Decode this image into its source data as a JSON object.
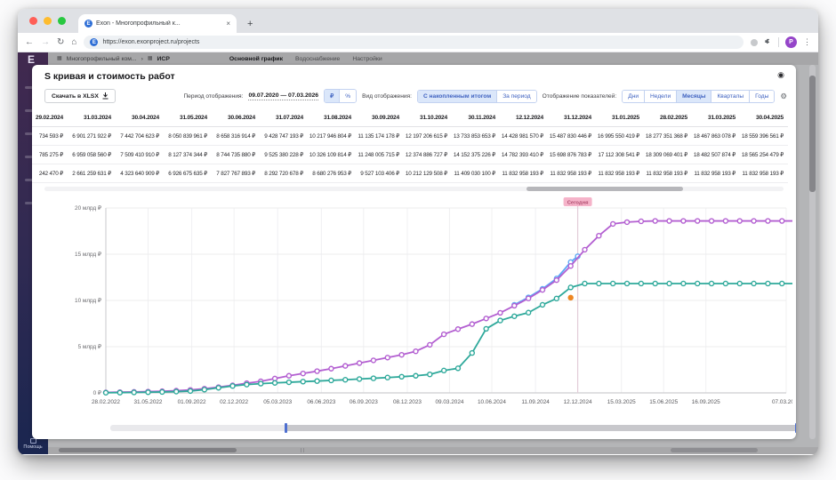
{
  "browser": {
    "tab_title": "Exon - Многопрофильный к...",
    "tab_close": "×",
    "new_tab": "+",
    "url": "https://exon.exonproject.ru/projects",
    "favicon_letter": "E",
    "avatar_letter": "P",
    "back_icon": "←",
    "forward_icon": "→",
    "reload_icon": "↻",
    "home_icon": "⌂",
    "kebab_icon": "⋮"
  },
  "app": {
    "logo_letter": "E",
    "help_label": "Помощь",
    "breadcrumb": {
      "project": "Многопрофильный ком...",
      "separator": "›",
      "current": "ИСР"
    },
    "nav_tabs": [
      "Основной график",
      "Водоснабжение",
      "Настройки"
    ],
    "active_nav_tab": "Основной график"
  },
  "panel": {
    "title": "S кривая и стоимость работ",
    "settings_icon": "◉",
    "gear_icon": "⚙",
    "download_label": "Скачать в XLSX",
    "period_label": "Период отображения:",
    "period_value": "09.07.2020 — 07.03.2026",
    "currency_options": [
      "₽",
      "%"
    ],
    "currency_selected": "₽",
    "view_label": "Вид отображения:",
    "view_options": [
      "С накопленным итогом",
      "За период"
    ],
    "view_selected": "С накопленным итогом",
    "granularity_label": "Отображение показателей:",
    "granularity_options": [
      "Дни",
      "Недели",
      "Месяцы",
      "Кварталы",
      "Годы"
    ],
    "granularity_selected": "Месяцы"
  },
  "table": {
    "columns": [
      "29.02.2024",
      "31.03.2024",
      "30.04.2024",
      "31.05.2024",
      "30.06.2024",
      "31.07.2024",
      "31.08.2024",
      "30.09.2024",
      "31.10.2024",
      "30.11.2024",
      "12.12.2024",
      "31.12.2024",
      "31.01.2025",
      "28.02.2025",
      "31.03.2025",
      "30.04.2025"
    ],
    "rows": [
      [
        "734 593 ₽",
        "6 901 271 922 ₽",
        "7 442 704 623 ₽",
        "8 050 839 961 ₽",
        "8 658 316 914 ₽",
        "9 428 747 193 ₽",
        "10 217 946 804 ₽",
        "11 135 174 178 ₽",
        "12 197 206 615 ₽",
        "13 733 853 653 ₽",
        "14 428 981 570 ₽",
        "15 487 830 446 ₽",
        "16 995 550 419 ₽",
        "18 277 351 368 ₽",
        "18 467 863 078 ₽",
        "18 559 396 561 ₽"
      ],
      [
        "785 275 ₽",
        "6 959 058 560 ₽",
        "7 509 410 910 ₽",
        "8 127 374 344 ₽",
        "8 744 735 880 ₽",
        "9 525 380 228 ₽",
        "10 326 109 814 ₽",
        "11 248 005 715 ₽",
        "12 374 886 727 ₽",
        "14 152 375 226 ₽",
        "14 782 393 410 ₽",
        "15 698 876 783 ₽",
        "17 112 308 541 ₽",
        "18 309 069 401 ₽",
        "18 482 507 874 ₽",
        "18 565 254 479 ₽"
      ],
      [
        "242 470 ₽",
        "2 661 259 631 ₽",
        "4 323 640 909 ₽",
        "6 926 675 635 ₽",
        "7 827 767 893 ₽",
        "8 292 720 678 ₽",
        "8 680 276 953 ₽",
        "9 527 103 406 ₽",
        "10 212 129 508 ₽",
        "11 409 030 100 ₽",
        "11 832 958 193 ₽",
        "11 832 958 193 ₽",
        "11 832 958 193 ₽",
        "11 832 958 193 ₽",
        "11 832 958 193 ₽",
        "11 832 958 193 ₽"
      ]
    ]
  },
  "chart_data": {
    "type": "line",
    "title": "S кривая и стоимость работ",
    "unit": "млрд ₽, накопленным итогом",
    "ylim": [
      0,
      20
    ],
    "y_ticks": [
      {
        "label": "0 ₽",
        "value": 0
      },
      {
        "label": "5 млрд ₽",
        "value": 5
      },
      {
        "label": "10 млрд ₽",
        "value": 10
      },
      {
        "label": "15 млрд ₽",
        "value": 15
      },
      {
        "label": "20 млрд ₽",
        "value": 20
      }
    ],
    "x_ticks": [
      {
        "label": "28.02.2022",
        "idx": 0
      },
      {
        "label": "31.05.2022",
        "idx": 3.0
      },
      {
        "label": "01.09.2022",
        "idx": 6.1
      },
      {
        "label": "02.12.2022",
        "idx": 9.1
      },
      {
        "label": "05.03.2023",
        "idx": 12.2
      },
      {
        "label": "06.06.2023",
        "idx": 15.3
      },
      {
        "label": "06.09.2023",
        "idx": 18.3
      },
      {
        "label": "08.12.2023",
        "idx": 21.4
      },
      {
        "label": "09.03.2024",
        "idx": 24.4
      },
      {
        "label": "10.06.2024",
        "idx": 27.4
      },
      {
        "label": "11.09.2024",
        "idx": 30.5
      },
      {
        "label": "12.12.2024",
        "idx": 33.5
      },
      {
        "label": "15.03.2025",
        "idx": 36.6
      },
      {
        "label": "15.06.2025",
        "idx": 39.6
      },
      {
        "label": "16.09.2025",
        "idx": 42.6
      },
      {
        "label": "07.03.2026",
        "idx": 48.3
      }
    ],
    "today": {
      "label": "Сегодня",
      "idx": 33.5
    },
    "series": [
      {
        "name": "series-blue",
        "color": "#5aa7f5",
        "x_idx": [
          29,
          30,
          31,
          32,
          33,
          33.5
        ],
        "values": [
          9.53,
          10.33,
          11.25,
          12.37,
          14.15,
          14.78
        ]
      },
      {
        "name": "series-purple",
        "color": "#b35fd1",
        "values": [
          0.05,
          0.08,
          0.11,
          0.14,
          0.18,
          0.24,
          0.32,
          0.45,
          0.62,
          0.82,
          1.05,
          1.25,
          1.55,
          1.85,
          2.1,
          2.35,
          2.62,
          2.92,
          3.22,
          3.52,
          3.82,
          4.12,
          4.5,
          5.2,
          6.34,
          6.9,
          7.44,
          8.05,
          8.66,
          9.43,
          10.22,
          11.14,
          12.2,
          13.73,
          15.49,
          17.0,
          18.28,
          18.47,
          18.56,
          18.6,
          18.6,
          18.6,
          18.6,
          18.6,
          18.6,
          18.6,
          18.6,
          18.6,
          18.6,
          18.6
        ]
      },
      {
        "name": "series-teal",
        "color": "#2fa99b",
        "values": [
          0.02,
          0.03,
          0.05,
          0.07,
          0.1,
          0.14,
          0.2,
          0.35,
          0.55,
          0.75,
          0.9,
          1.0,
          1.08,
          1.15,
          1.22,
          1.28,
          1.35,
          1.42,
          1.5,
          1.58,
          1.66,
          1.75,
          1.85,
          2.0,
          2.42,
          2.66,
          4.32,
          6.93,
          7.83,
          8.29,
          8.68,
          9.53,
          10.21,
          11.41,
          11.83,
          11.83,
          11.83,
          11.83,
          11.83,
          11.83,
          11.83,
          11.83,
          11.83,
          11.83,
          11.83,
          11.83,
          11.83,
          11.83,
          11.83,
          11.83
        ]
      }
    ],
    "point_marker": {
      "name": "milestone-orange",
      "color": "#ee8622",
      "idx": 33.0,
      "value": 10.3
    },
    "grid": true,
    "legend": "none"
  }
}
